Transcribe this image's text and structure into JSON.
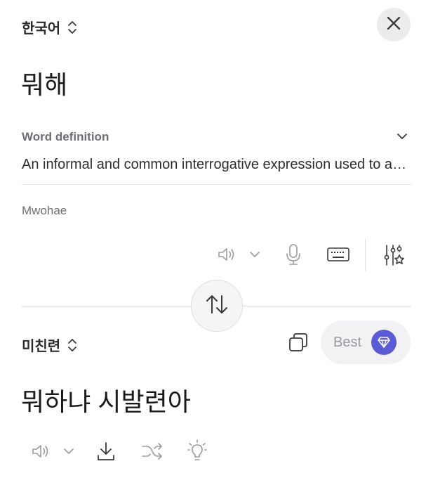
{
  "source": {
    "language": "한국어",
    "text": "뭐해",
    "definition_label": "Word definition",
    "definition_text": "An informal and common interrogative expression used to ask what someone is doing",
    "romanization": "Mwohae"
  },
  "target": {
    "language": "미친련",
    "text": "뭐하냐 시발련아",
    "best_label": "Best"
  },
  "colors": {
    "accent": "#5b5bd6",
    "icon_gray": "#9a9aa0",
    "icon_dark": "#3a3a3c"
  },
  "icons": {
    "close": "close-icon",
    "speaker": "speaker-icon",
    "mic": "microphone-icon",
    "keyboard": "keyboard-icon",
    "settings": "sliders-star-icon",
    "swap": "swap-arrows-icon",
    "copy": "copy-icon",
    "gem": "gem-icon",
    "download": "download-icon",
    "shuffle": "shuffle-icon",
    "bulb": "lightbulb-icon"
  }
}
